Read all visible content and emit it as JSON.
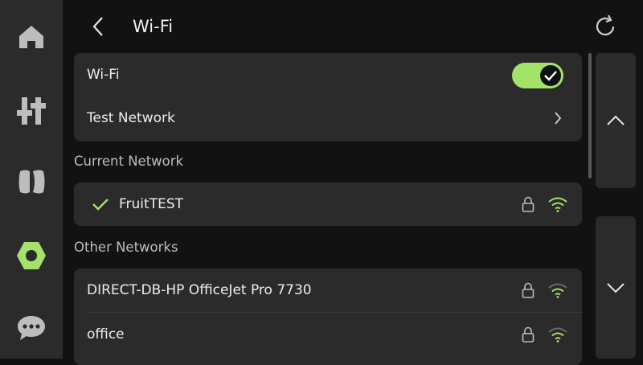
{
  "header": {
    "title": "Wi-Fi"
  },
  "sidebar": {
    "items": [
      {
        "name": "home",
        "icon": "home-icon"
      },
      {
        "name": "controls",
        "icon": "sliders-icon"
      },
      {
        "name": "filament",
        "icon": "filament-icon"
      },
      {
        "name": "settings",
        "icon": "gear-icon",
        "active": true
      },
      {
        "name": "messages",
        "icon": "chat-icon"
      }
    ]
  },
  "wifi_card": {
    "toggle_label": "Wi-Fi",
    "toggle_on": true,
    "test_network_label": "Test Network"
  },
  "current_network": {
    "section_label": "Current Network",
    "ssid": "FruitTEST",
    "secured": true,
    "connected": true
  },
  "other_networks": {
    "section_label": "Other Networks",
    "items": [
      {
        "ssid": "DIRECT-DB-HP OfficeJet Pro 7730",
        "secured": true
      },
      {
        "ssid": "office",
        "secured": true
      }
    ]
  },
  "colors": {
    "accent": "#a3e36a",
    "background": "#121212",
    "panel": "#2b2b2b",
    "text": "#ededed",
    "muted": "#bdbdbd"
  }
}
